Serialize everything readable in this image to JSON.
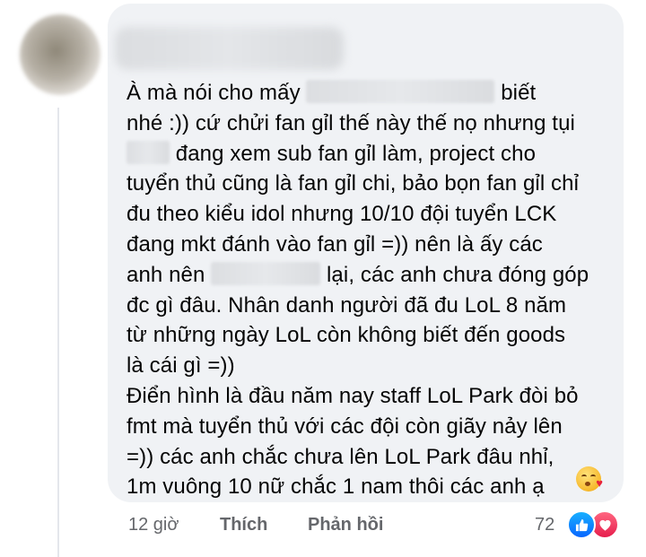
{
  "comment": {
    "lines": [
      {
        "segments": [
          {
            "text": "À mà nói cho mấy "
          },
          {
            "redact": true,
            "w": 210
          },
          {
            "text": " biết"
          }
        ]
      },
      {
        "segments": [
          {
            "text": "nhé :)) cứ chửi fan gỉl thế này thế nọ nhưng tụi"
          }
        ]
      },
      {
        "segments": [
          {
            "redact": true,
            "w": 48
          },
          {
            "text": " đang xem sub fan gỉl làm, project cho"
          }
        ]
      },
      {
        "segments": [
          {
            "text": "tuyển thủ cũng là fan gỉl chi, bảo bọn fan gỉl chỉ"
          }
        ]
      },
      {
        "segments": [
          {
            "text": "đu theo kiểu idol nhưng 10/10 đội tuyển LCK"
          }
        ]
      },
      {
        "segments": [
          {
            "text": "đang mkt đánh vào fan gỉl =)) nên là ấy các"
          }
        ]
      },
      {
        "segments": [
          {
            "text": "anh nên "
          },
          {
            "redact": true,
            "w": 122
          },
          {
            "text": " lại, các anh chưa đóng góp"
          }
        ]
      },
      {
        "segments": [
          {
            "text": "đc gì đâu. Nhân danh người đã đu LoL 8 năm"
          }
        ]
      },
      {
        "segments": [
          {
            "text": "từ những ngày LoL còn không biết đến goods"
          }
        ]
      },
      {
        "segments": [
          {
            "text": "là cái gì =))"
          }
        ]
      },
      {
        "segments": [
          {
            "text": "Điển hình là đầu năm nay staff LoL Park đòi bỏ"
          }
        ]
      },
      {
        "segments": [
          {
            "text": "fmt mà tuyển thủ với các đội còn giãy nảy lên"
          }
        ]
      },
      {
        "segments": [
          {
            "text": "=)) các anh chắc chưa lên LoL Park đâu nhỉ,"
          }
        ]
      },
      {
        "segments": [
          {
            "text": "1m vuông 10 nữ chắc 1 nam thôi các anh ạ"
          }
        ]
      }
    ]
  },
  "actions": {
    "time": "12 giờ",
    "like": "Thích",
    "reply": "Phản hồi"
  },
  "reactions": {
    "count": "72",
    "icons": [
      "like-icon",
      "heart-icon"
    ]
  },
  "colors": {
    "bubble": "#f0f2f5",
    "meta_text": "#65676b",
    "like": "#0866ff",
    "heart": "#e61e4d"
  }
}
